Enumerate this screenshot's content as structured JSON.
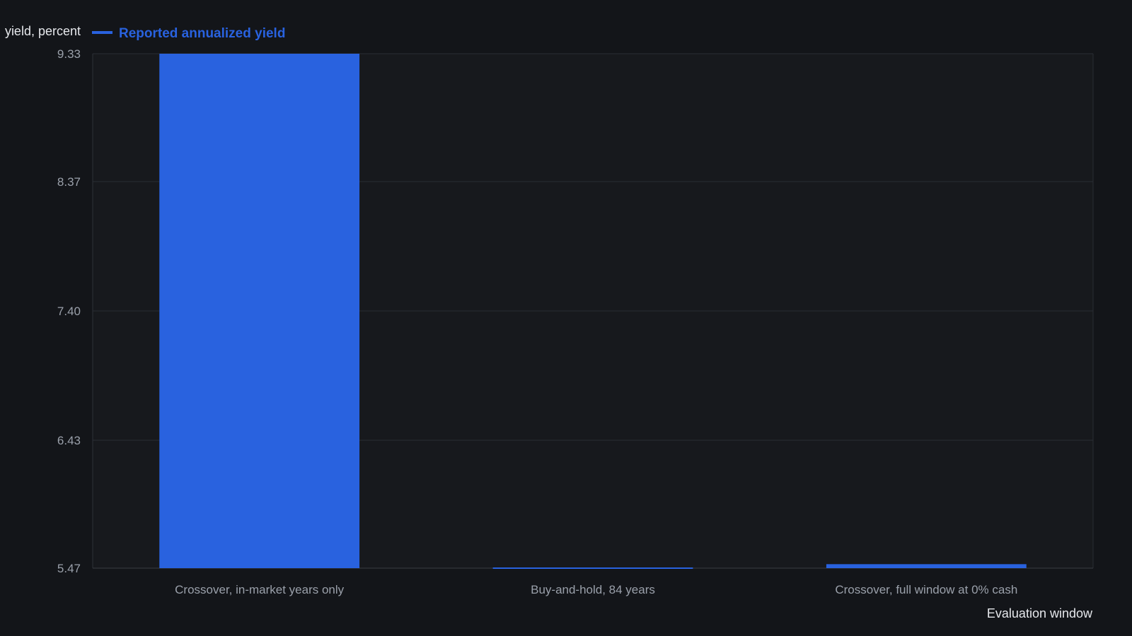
{
  "chart_data": {
    "type": "bar",
    "categories": [
      "Crossover, in-market years only",
      "Buy-and-hold, 84 years",
      "Crossover, full window at 0% cash"
    ],
    "series": [
      {
        "name": "Reported annualized yield",
        "values": [
          9.33,
          5.46,
          5.5
        ],
        "color": "#2962df"
      }
    ],
    "ylabel": "yield, percent",
    "xlabel": "Evaluation window",
    "yticks": [
      "9.33",
      "8.37",
      "7.40",
      "6.43",
      "5.47"
    ],
    "ylim": [
      5.47,
      9.33
    ],
    "grid": true,
    "legend_position": "top-left"
  }
}
